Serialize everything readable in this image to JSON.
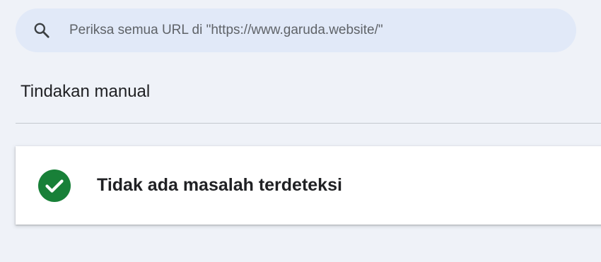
{
  "search": {
    "placeholder": "Periksa semua URL di \"https://www.garuda.website/\"",
    "icon": "search-icon"
  },
  "section": {
    "title": "Tindakan manual"
  },
  "status_card": {
    "icon": "check-circle-icon",
    "icon_color": "#188038",
    "message": "Tidak ada masalah terdeteksi"
  },
  "colors": {
    "page_background": "#eff2f8",
    "search_background": "#e1e9f8",
    "text_primary": "#202124",
    "text_secondary": "#5f6368"
  }
}
